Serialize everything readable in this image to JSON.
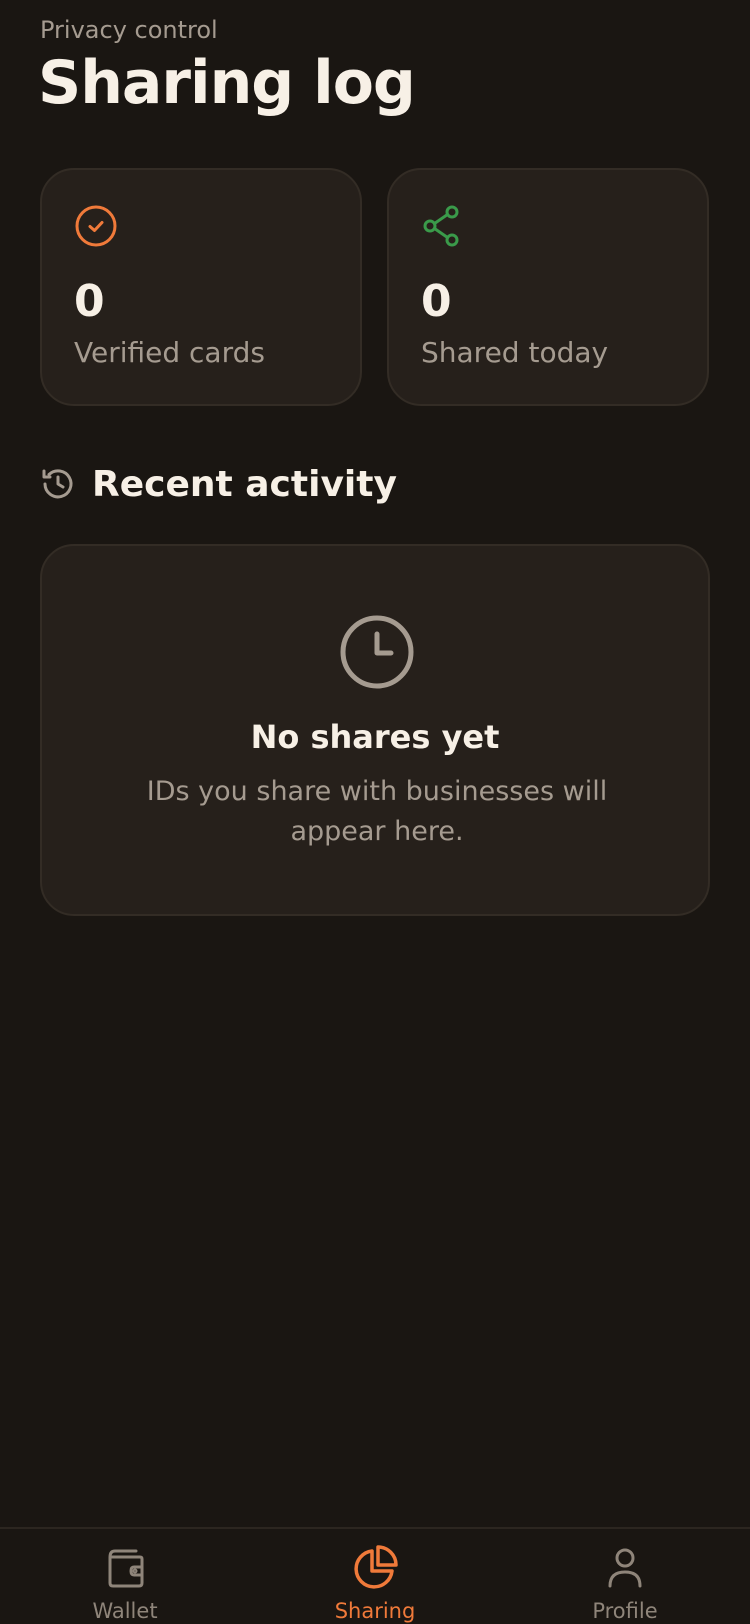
{
  "header": {
    "eyebrow": "Privacy control",
    "title": "Sharing log"
  },
  "stats": [
    {
      "icon": "check-circle-icon",
      "value": "0",
      "label": "Verified cards",
      "color": "#f07a3a"
    },
    {
      "icon": "share-icon",
      "value": "0",
      "label": "Shared today",
      "color": "#3a9a4a"
    }
  ],
  "recent": {
    "icon": "history-icon",
    "title": "Recent activity"
  },
  "empty_state": {
    "icon": "clock-icon",
    "title": "No shares yet",
    "description": "IDs you share with businesses will appear here."
  },
  "tabbar": {
    "items": [
      {
        "label": "Wallet",
        "icon": "wallet-icon",
        "active": false
      },
      {
        "label": "Sharing",
        "icon": "pie-chart-icon",
        "active": true
      },
      {
        "label": "Profile",
        "icon": "user-icon",
        "active": false
      }
    ]
  },
  "colors": {
    "accent": "#f07a3a",
    "share_green": "#3a9a4a",
    "background": "#1a1612",
    "card": "#26201b",
    "muted_text": "#a59b90"
  }
}
